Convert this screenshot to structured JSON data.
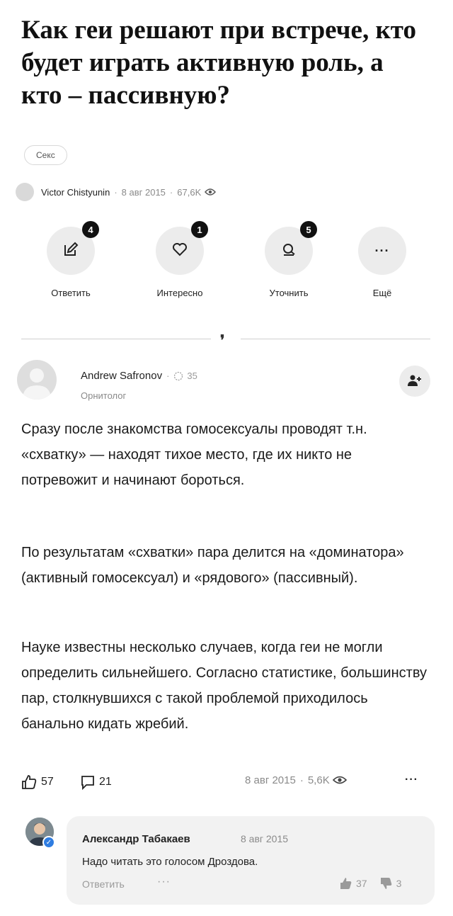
{
  "question": {
    "title": "Как геи решают при встрече, кто будет играть активную роль, а кто – пассивную?",
    "tag": "Секс",
    "author": "Victor Chistyunin",
    "date": "8 авг 2015",
    "views": "67,6K"
  },
  "actions": [
    {
      "label": "Ответить",
      "badge": "4",
      "icon": "edit-icon"
    },
    {
      "label": "Интересно",
      "badge": "1",
      "icon": "heart-icon"
    },
    {
      "label": "Уточнить",
      "badge": "5",
      "icon": "comment-icon"
    },
    {
      "label": "Ещё",
      "badge": "",
      "icon": "more-icon"
    }
  ],
  "divider_mark": "❜",
  "answer": {
    "author": "Andrew Safronov",
    "rating": "35",
    "role": "Орнитолог",
    "paragraphs": [
      "Сразу после знакомства гомосексуалы проводят т.н. «схватку» — находят тихое место, где их никто не потревожит и начинают бороться.",
      "По результатам «схватки» пара делится на «доминатора» (активный гомосексуал) и «рядового» (пассивный).",
      "Науке известны несколько случаев, когда геи не могли определить сильнейшего. Согласно статистике, большинству пар, столкнувшихся с такой проблемой приходилось банально кидать жребий."
    ],
    "likes": "57",
    "comments": "21",
    "date": "8 авг 2015",
    "views": "5,6K",
    "more": "···"
  },
  "comment": {
    "author": "Александр Табакаев",
    "date": "8 авг 2015",
    "text": "Надо читать это голосом Дроздова.",
    "reply_label": "Ответить",
    "more": "···",
    "likes": "37",
    "dislikes": "3"
  },
  "colors": {
    "badge": "#111111",
    "circle_bg": "#ececec",
    "verify": "#2f7de1",
    "comment_bg": "#f2f2f2"
  }
}
